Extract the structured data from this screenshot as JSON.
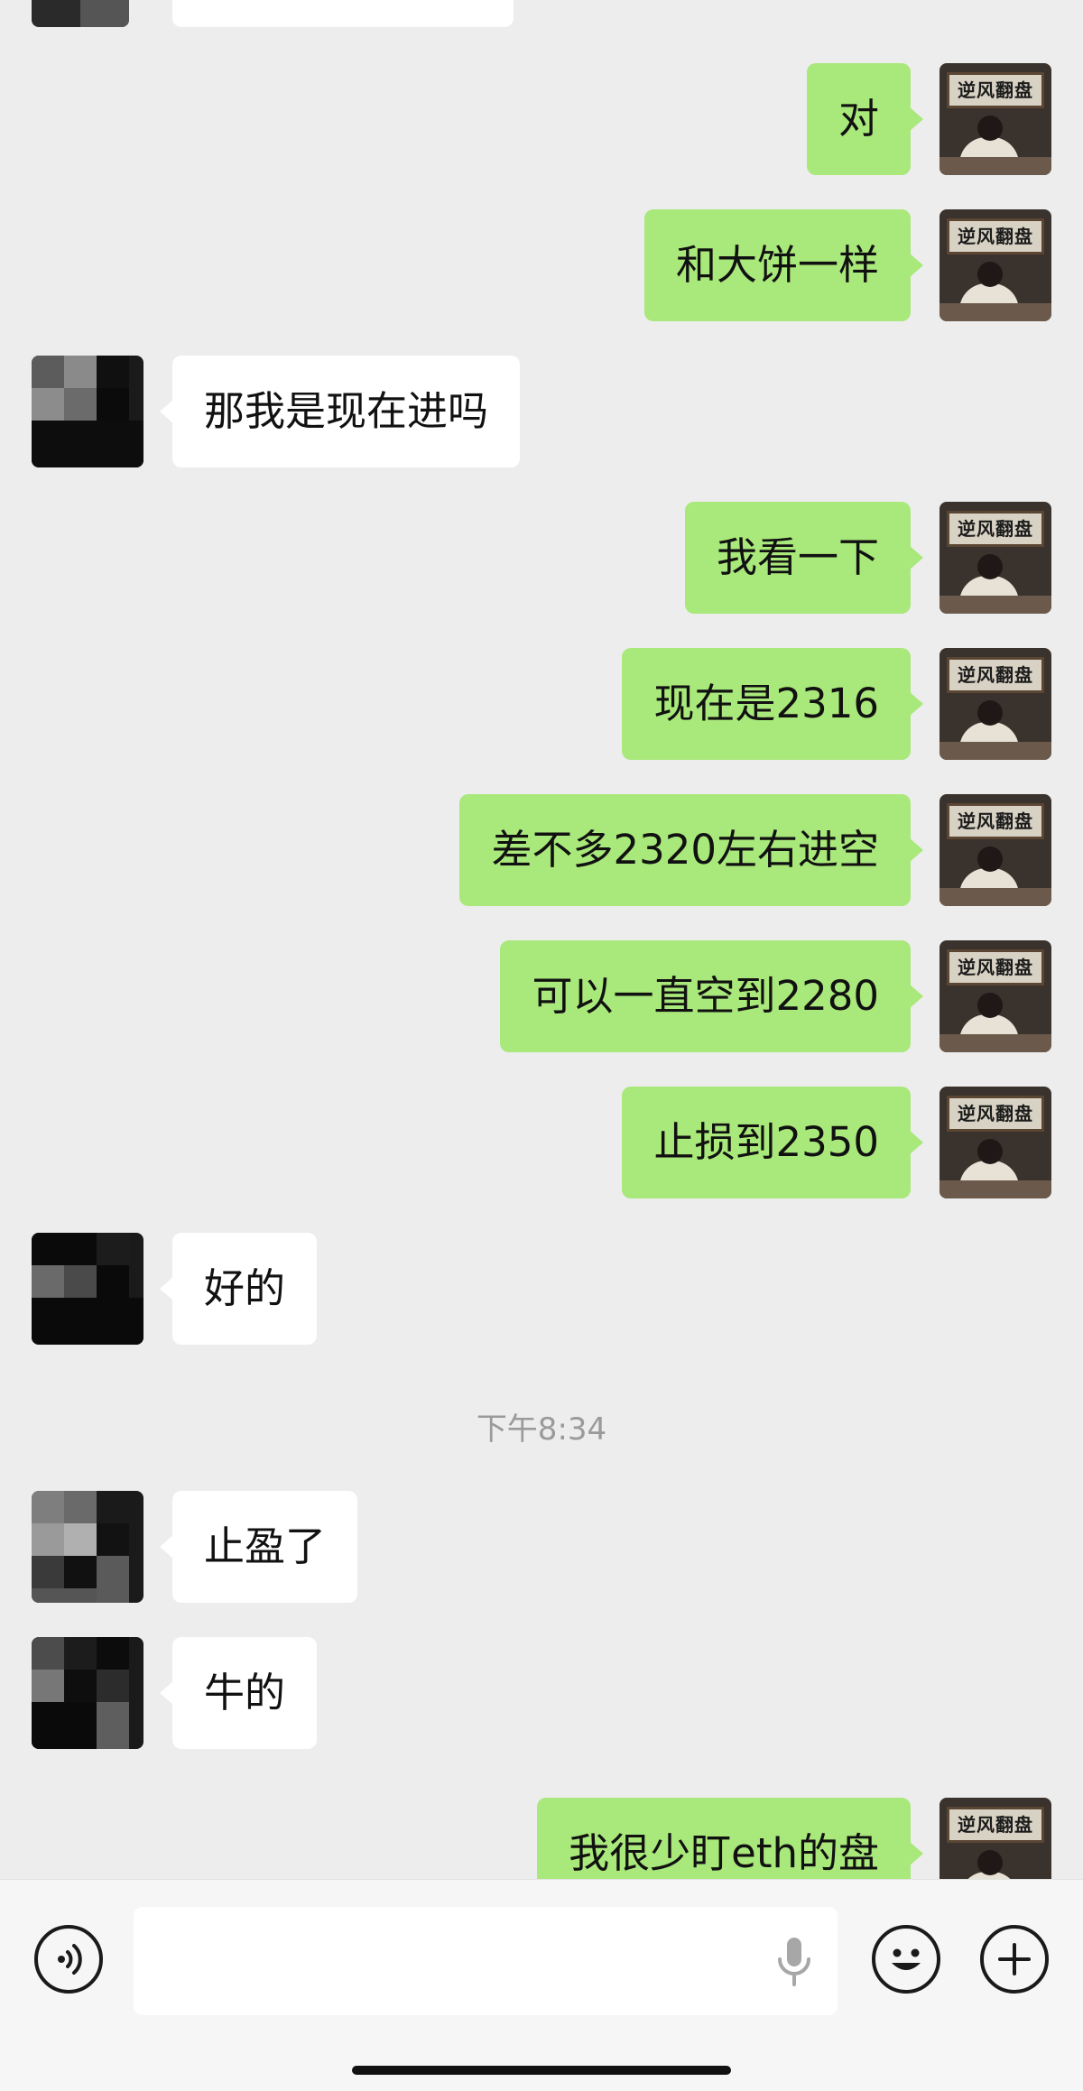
{
  "messages": [
    {
      "side": "self",
      "text": "对"
    },
    {
      "side": "self",
      "text": "和大饼一样"
    },
    {
      "side": "other",
      "text": "那我是现在进吗"
    },
    {
      "side": "self",
      "text": "我看一下"
    },
    {
      "side": "self",
      "text": "现在是2316"
    },
    {
      "side": "self",
      "text": "差不多2320左右进空"
    },
    {
      "side": "self",
      "text": "可以一直空到2280"
    },
    {
      "side": "self",
      "text": "止损到2350"
    },
    {
      "side": "other",
      "text": "好的"
    },
    {
      "side": "other",
      "text": "止盈了"
    },
    {
      "side": "other",
      "text": "牛的"
    },
    {
      "side": "self",
      "text": "我很少盯eth的盘"
    }
  ],
  "timestamp": "下午8:34",
  "self_avatar_sign": "逆风翻盘",
  "input_bar": {
    "voice_icon": "voice-toggle-icon",
    "mic_icon": "microphone-icon",
    "emoji_icon": "emoji-icon",
    "plus_icon": "plus-icon"
  },
  "colors": {
    "self_bubble": "#a9e87a",
    "other_bubble": "#ffffff",
    "background": "#ededed"
  }
}
